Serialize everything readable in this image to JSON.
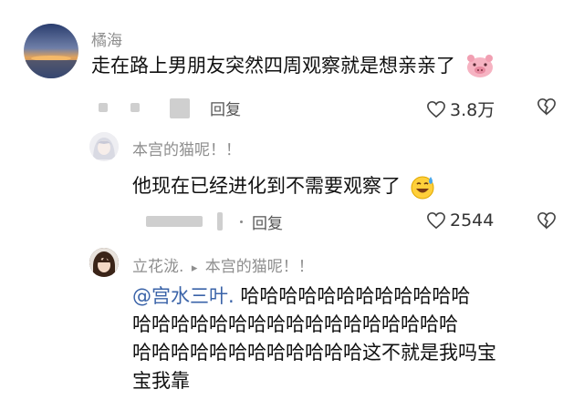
{
  "comment1": {
    "username": "橘海",
    "text": "走在路上男朋友突然四周观察就是想亲亲了",
    "emoji_icon": "pig-face-emoji-icon",
    "reply_label": "回复",
    "like_count": "3.8万"
  },
  "comment2": {
    "username": "本宫的猫呢！！",
    "text": "他现在已经进化到不需要观察了",
    "emoji_icon": "sweat-smile-emoji-icon",
    "reply_label": "回复",
    "like_count": "2544"
  },
  "comment3": {
    "username": "立花泷.",
    "reply_arrow": "▸",
    "reply_to": "本宫的猫呢！！",
    "mention": "@宫水三叶.",
    "line1_rest": " 哈哈哈哈哈哈哈哈哈哈哈哈",
    "line2": "哈哈哈哈哈哈哈哈哈哈哈哈哈哈哈哈哈",
    "line3": "哈哈哈哈哈哈哈哈哈哈哈哈这不就是我吗宝",
    "line4": "宝我靠"
  },
  "colors": {
    "mention": "#3a63a8",
    "text": "#111111",
    "meta": "#8e8e8e"
  }
}
